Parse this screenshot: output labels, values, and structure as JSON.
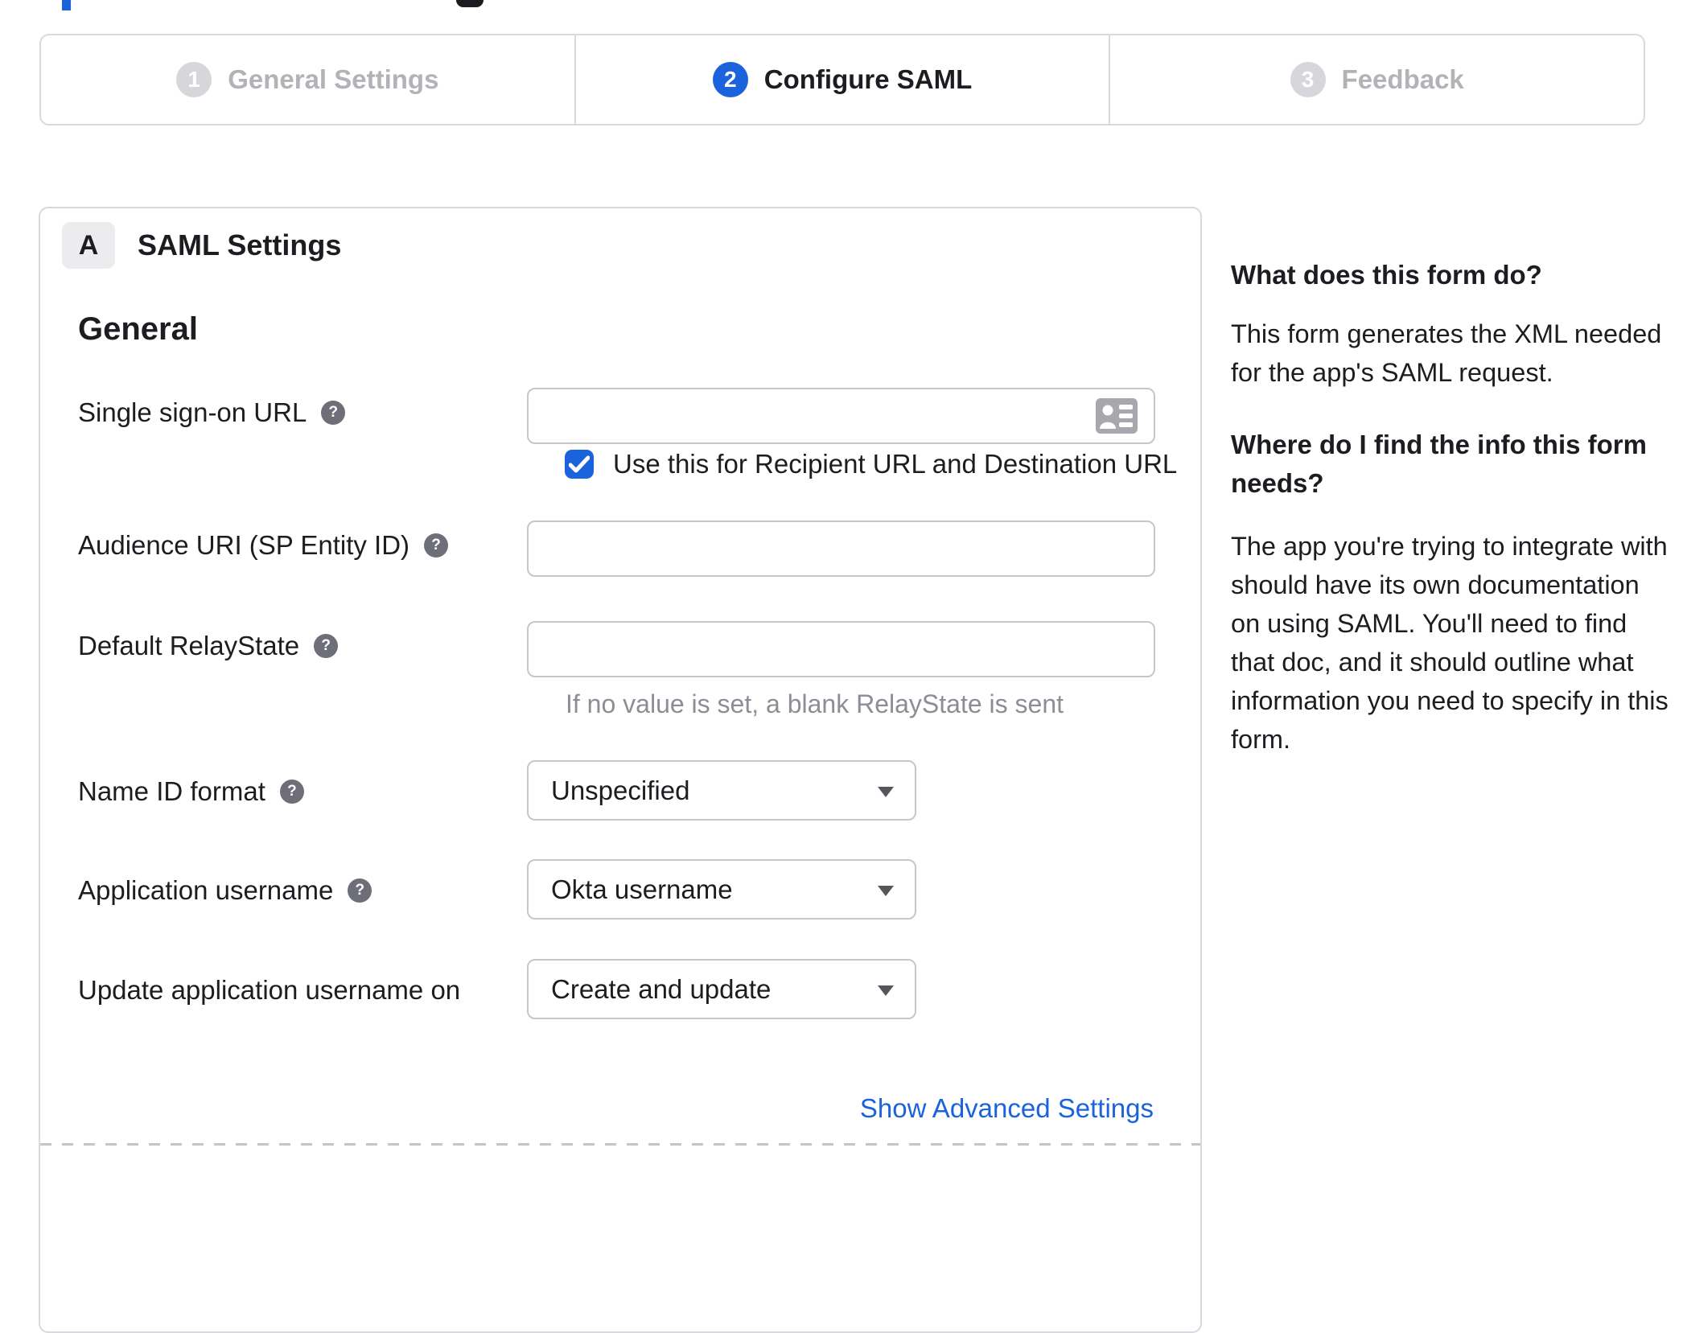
{
  "stepper": {
    "steps": [
      {
        "number": "1",
        "label": "General Settings",
        "state": "inactive"
      },
      {
        "number": "2",
        "label": "Configure SAML",
        "state": "active"
      },
      {
        "number": "3",
        "label": "Feedback",
        "state": "inactive"
      }
    ]
  },
  "panel": {
    "section_letter": "A",
    "section_title": "SAML Settings",
    "group_title": "General",
    "fields": {
      "sso": {
        "label": "Single sign-on URL",
        "value": "",
        "checkbox_label": "Use this for Recipient URL and Destination URL",
        "checkbox_checked": true
      },
      "audience": {
        "label": "Audience URI (SP Entity ID)",
        "value": ""
      },
      "relay": {
        "label": "Default RelayState",
        "value": "",
        "hint": "If no value is set, a blank RelayState is sent"
      },
      "name_id": {
        "label": "Name ID format",
        "value": "Unspecified"
      },
      "app_username": {
        "label": "Application username",
        "value": "Okta username"
      },
      "update_username": {
        "label": "Update application username on",
        "value": "Create and update"
      }
    },
    "advanced_link": "Show Advanced Settings"
  },
  "sidebar": {
    "heading1": "What does this form do?",
    "para1": "This form generates the XML needed for the app's SAML request.",
    "heading2": "Where do I find the info this form needs?",
    "para2": "The app you're trying to integrate with should have its own documentation on using SAML. You'll need to find that doc, and it should outline what information you need to specify in this form."
  },
  "icons": {
    "help": "?"
  },
  "colors": {
    "accent_blue": "#1b63dc",
    "step_inactive_circle": "#d7d7db",
    "step_inactive_text": "#b2b2b7",
    "text": "#1d1d21",
    "border": "#d9d9de",
    "muted": "#8d8d95",
    "help_badge_bg": "#6e6e78"
  }
}
